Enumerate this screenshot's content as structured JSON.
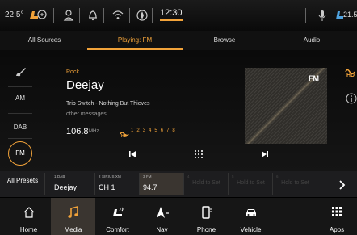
{
  "status": {
    "temp_left": "22.5°",
    "time": "12:30",
    "temp_right": "21.5"
  },
  "tabs": [
    {
      "label": "All Sources"
    },
    {
      "label": "Playing: FM"
    },
    {
      "label": "Browse"
    },
    {
      "label": "Audio"
    }
  ],
  "sources": {
    "am": "AM",
    "dab": "DAB",
    "fm": "FM"
  },
  "now_playing": {
    "genre": "Rock",
    "station": "Deejay",
    "track": "Trip Switch - Nothing But Thieves",
    "extra": "other messages",
    "frequency": "106.8",
    "unit": "MHz",
    "hd_channels": [
      "1",
      "2",
      "3",
      "4",
      "5",
      "6",
      "7",
      "8"
    ],
    "album_label": "FM"
  },
  "presets": {
    "all_label": "All Presets",
    "items": [
      {
        "num": "1 DAB",
        "value": "Deejay"
      },
      {
        "num": "2 SIRIUS XM",
        "value": "CH 1"
      },
      {
        "num": "3 FM",
        "value": "94.7"
      },
      {
        "num": "4",
        "value": "Hold to Set"
      },
      {
        "num": "5",
        "value": "Hold to Set"
      },
      {
        "num": "6",
        "value": "Hold to Set"
      }
    ]
  },
  "nav": [
    {
      "label": "Home",
      "icon": "home-icon"
    },
    {
      "label": "Media",
      "icon": "music-note-icon"
    },
    {
      "label": "Comfort",
      "icon": "comfort-seat-icon"
    },
    {
      "label": "Nav",
      "icon": "navigation-arrow-icon"
    },
    {
      "label": "Phone",
      "icon": "phone-icon"
    },
    {
      "label": "Vehicle",
      "icon": "vehicle-icon"
    },
    {
      "label": "Apps",
      "icon": "apps-grid-icon"
    }
  ],
  "colors": {
    "accent": "#f2a33a",
    "background": "#000000"
  }
}
